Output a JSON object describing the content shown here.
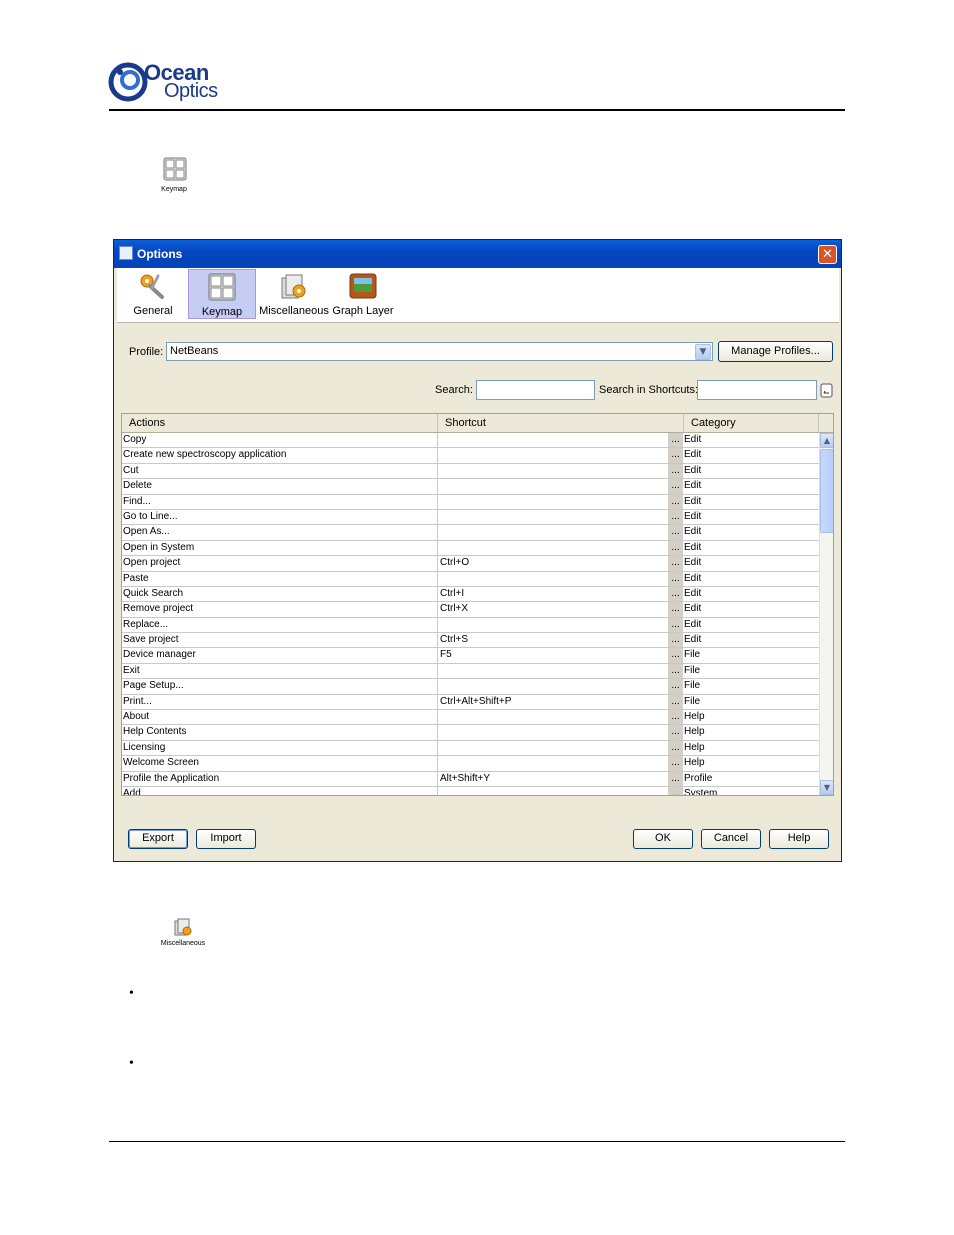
{
  "logo": {
    "line1": "Ocean",
    "line2": "Optics"
  },
  "keymap_small_icon": {
    "label": "Keymap"
  },
  "misc_small_icon": {
    "label": "Miscellaneous"
  },
  "dialog": {
    "title": "Options",
    "close_glyph": "✕",
    "categories": [
      {
        "label": "General",
        "icon": "wrench-gear-icon"
      },
      {
        "label": "Keymap",
        "icon": "keyboard-icon",
        "selected": true
      },
      {
        "label": "Miscellaneous",
        "icon": "misc-gear-icon"
      },
      {
        "label": "Graph Layer",
        "icon": "graph-layer-icon"
      }
    ],
    "profile_label": "Profile:",
    "profile_value": "NetBeans",
    "manage_profiles_label": "Manage Profiles...",
    "search_label": "Search:",
    "search_value": "",
    "search_shortcuts_label": "Search in Shortcuts:",
    "search_shortcuts_value": "",
    "columns": {
      "actions": "Actions",
      "shortcut": "Shortcut",
      "category": "Category"
    },
    "dots": "...",
    "rows": [
      {
        "action": "Copy",
        "shortcut": "",
        "category": "Edit"
      },
      {
        "action": "Create new spectroscopy application",
        "shortcut": "",
        "category": "Edit"
      },
      {
        "action": "Cut",
        "shortcut": "",
        "category": "Edit"
      },
      {
        "action": "Delete",
        "shortcut": "",
        "category": "Edit"
      },
      {
        "action": "Find...",
        "shortcut": "",
        "category": "Edit"
      },
      {
        "action": "Go to Line...",
        "shortcut": "",
        "category": "Edit"
      },
      {
        "action": "Open As...",
        "shortcut": "",
        "category": "Edit"
      },
      {
        "action": "Open in System",
        "shortcut": "",
        "category": "Edit"
      },
      {
        "action": "Open project",
        "shortcut": "Ctrl+O",
        "category": "Edit"
      },
      {
        "action": "Paste",
        "shortcut": "",
        "category": "Edit"
      },
      {
        "action": "Quick Search",
        "shortcut": "Ctrl+I",
        "category": "Edit"
      },
      {
        "action": "Remove project",
        "shortcut": "Ctrl+X",
        "category": "Edit"
      },
      {
        "action": "Replace...",
        "shortcut": "",
        "category": "Edit"
      },
      {
        "action": "Save project",
        "shortcut": "Ctrl+S",
        "category": "Edit"
      },
      {
        "action": "Device manager",
        "shortcut": "F5",
        "category": "File"
      },
      {
        "action": "Exit",
        "shortcut": "",
        "category": "File"
      },
      {
        "action": "Page Setup...",
        "shortcut": "",
        "category": "File"
      },
      {
        "action": "Print...",
        "shortcut": "Ctrl+Alt+Shift+P",
        "category": "File"
      },
      {
        "action": "About",
        "shortcut": "",
        "category": "Help"
      },
      {
        "action": "Help Contents",
        "shortcut": "",
        "category": "Help"
      },
      {
        "action": "Licensing",
        "shortcut": "",
        "category": "Help"
      },
      {
        "action": "Welcome Screen",
        "shortcut": "",
        "category": "Help"
      },
      {
        "action": "Profile the Application",
        "shortcut": "Alt+Shift+Y",
        "category": "Profile"
      },
      {
        "action": "Add",
        "shortcut": "",
        "category": "System"
      }
    ],
    "buttons": {
      "export": "Export",
      "import": "Import",
      "ok": "OK",
      "cancel": "Cancel",
      "help": "Help"
    }
  },
  "bullets": [
    "•",
    "•"
  ]
}
